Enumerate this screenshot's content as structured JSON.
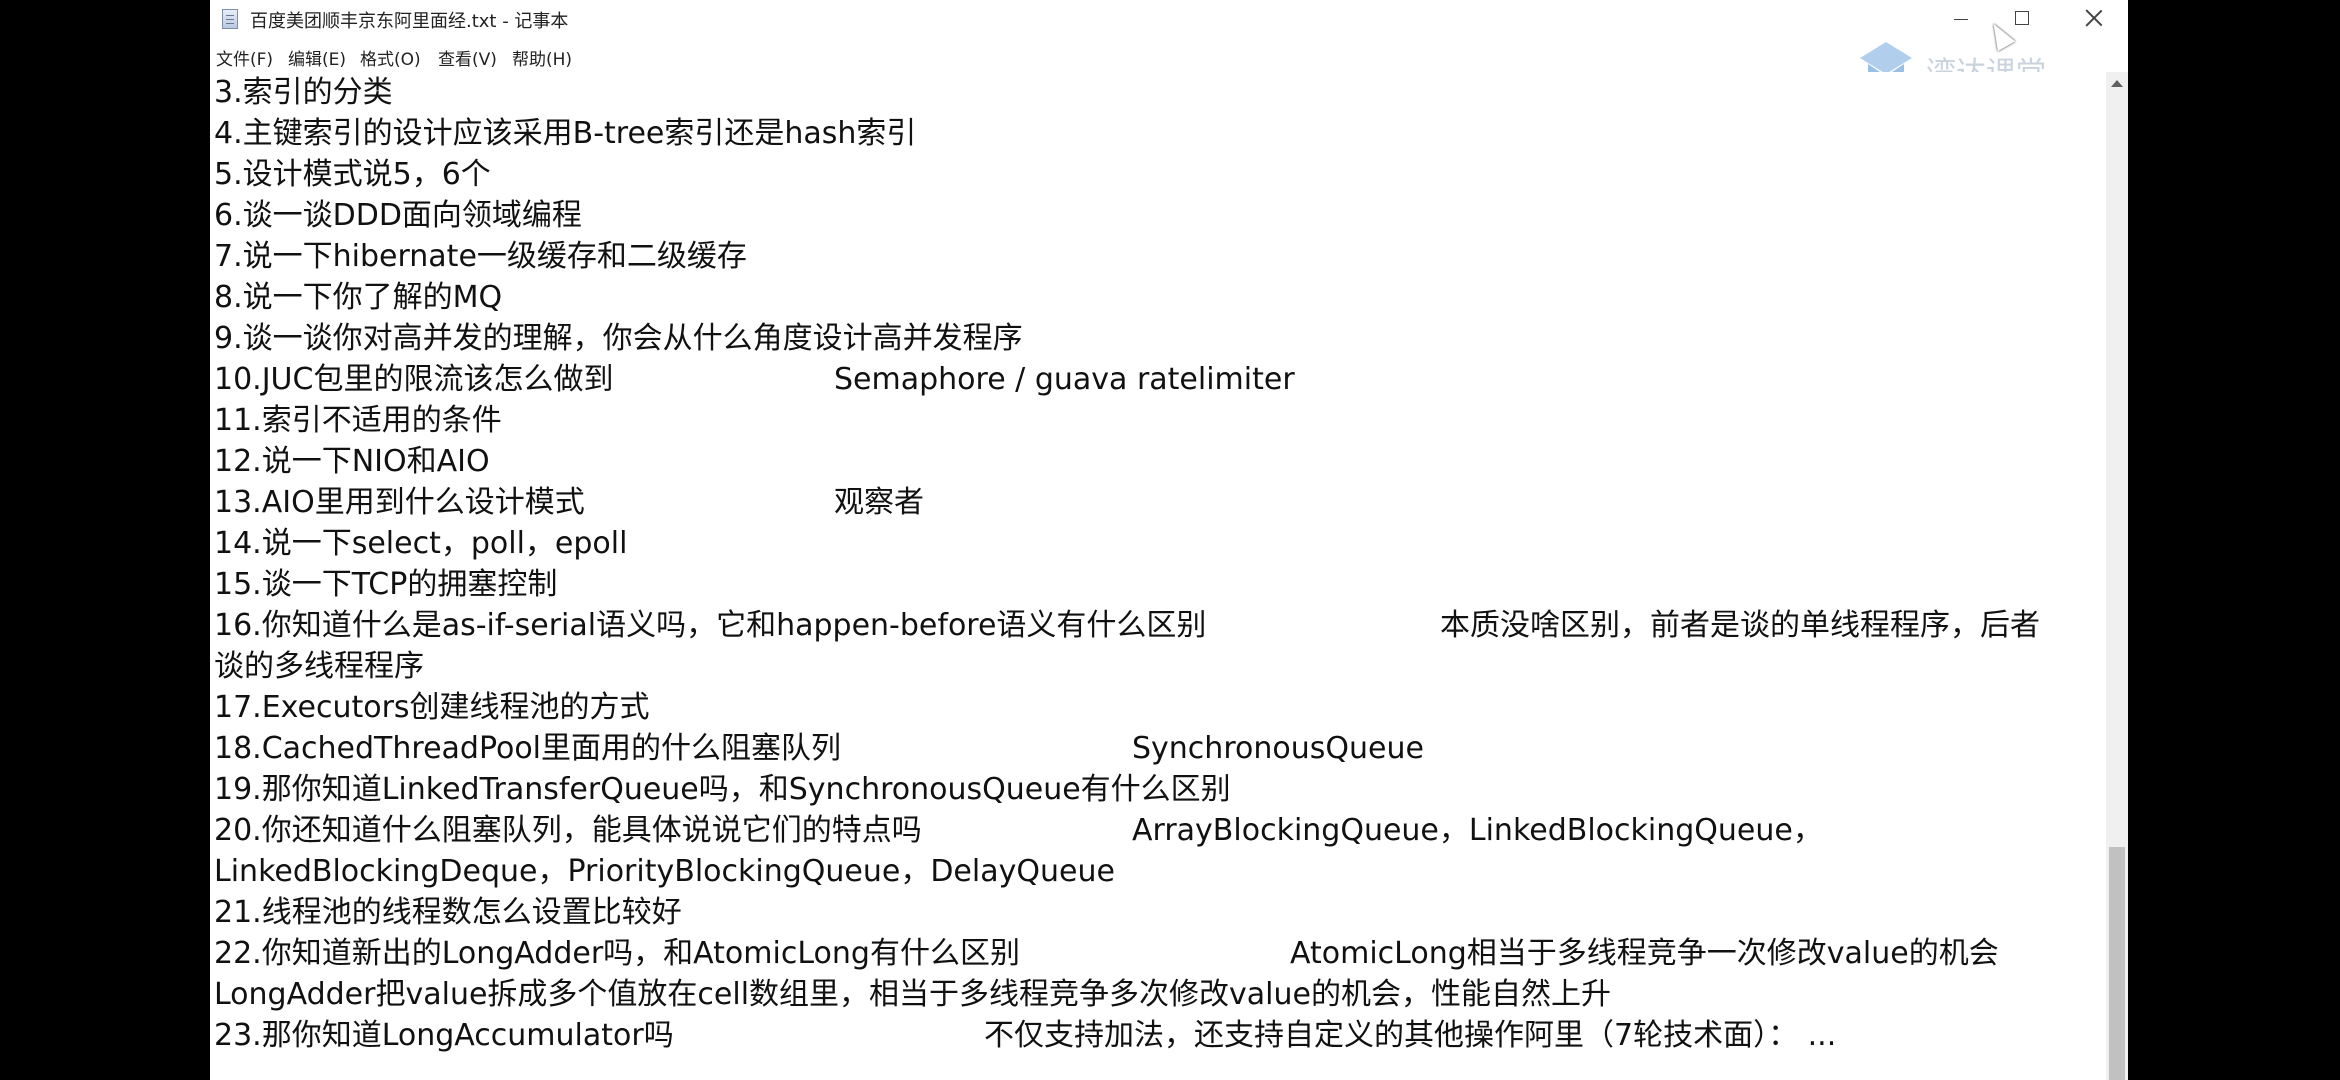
{
  "window": {
    "title": "百度美团顺丰京东阿里面经.txt - 记事本"
  },
  "menu": {
    "file": "文件(F)",
    "edit": "编辑(E)",
    "format": "格式(O)",
    "view": "查看(V)",
    "help": "帮助(H)"
  },
  "watermark": {
    "brand": "湾达课堂"
  },
  "lines": [
    {
      "q": "3.索引的分类",
      "a": ""
    },
    {
      "q": "4.主键索引的设计应该采用B-tree索引还是hash索引",
      "a": ""
    },
    {
      "q": "5.设计模式说5，6个",
      "a": ""
    },
    {
      "q": "6.谈一谈DDD面向领域编程",
      "a": ""
    },
    {
      "q": "7.说一下hibernate一级缓存和二级缓存",
      "a": ""
    },
    {
      "q": "8.说一下你了解的MQ",
      "a": ""
    },
    {
      "q": "9.谈一谈你对高并发的理解，你会从什么角度设计高并发程序",
      "a": ""
    },
    {
      "q": "10.JUC包里的限流该怎么做到",
      "a": "Semaphore / guava ratelimiter"
    },
    {
      "q": "11.索引不适用的条件",
      "a": ""
    },
    {
      "q": "12.说一下NIO和AIO",
      "a": ""
    },
    {
      "q": "13.AIO里用到什么设计模式",
      "a": "观察者"
    },
    {
      "q": "14.说一下select，poll，epoll",
      "a": ""
    },
    {
      "q": "15.谈一下TCP的拥塞控制",
      "a": ""
    },
    {
      "q": "16.你知道什么是as-if-serial语义吗，它和happen-before语义有什么区别",
      "a": "本质没啥区别，前者是谈的单线程程序，后者"
    },
    {
      "q": "谈的多线程程序",
      "a": ""
    },
    {
      "q": "17.Executors创建线程池的方式",
      "a": ""
    },
    {
      "q": "18.CachedThreadPool里面用的什么阻塞队列",
      "a": "SynchronousQueue"
    },
    {
      "q": "19.那你知道LinkedTransferQueue吗，和SynchronousQueue有什么区别",
      "a": ""
    },
    {
      "q": "20.你还知道什么阻塞队列，能具体说说它们的特点吗",
      "a": "ArrayBlockingQueue，LinkedBlockingQueue，"
    },
    {
      "q": "LinkedBlockingDeque，PriorityBlockingQueue，DelayQueue",
      "a": ""
    },
    {
      "q": "21.线程池的线程数怎么设置比较好",
      "a": ""
    },
    {
      "q": "22.你知道新出的LongAdder吗，和AtomicLong有什么区别",
      "a": "AtomicLong相当于多线程竞争一次修改value的机会"
    },
    {
      "q": "LongAdder把value拆成多个值放在cell数组里，相当于多线程竞争多次修改value的机会，性能自然上升",
      "a": ""
    },
    {
      "q": "23.那你知道LongAccumulator吗",
      "a": "不仅支持加法，还支持自定义的其他操作阿里（7轮技术面）：   ..."
    }
  ]
}
